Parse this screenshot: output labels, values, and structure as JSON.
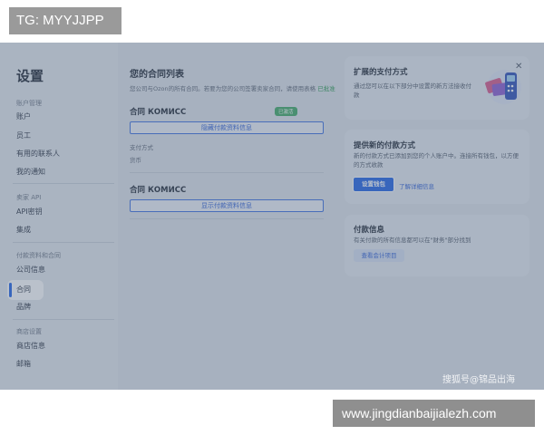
{
  "watermark_top": "TG: MYYJJPP",
  "watermark_bottom": "www.jingdianbaijialezh.com",
  "watermark_corner": "搜狐号@锦品出海",
  "sidebar": {
    "title": "设置",
    "sections": [
      {
        "label": "账户管理",
        "items": [
          "账户",
          "员工",
          "有用的联系人",
          "我的通知"
        ]
      },
      {
        "label": "卖家 API",
        "items": [
          "API密钥",
          "集成"
        ]
      },
      {
        "label": "付款资料和合同",
        "items": [
          "公司信息",
          "合同",
          "品牌"
        ]
      },
      {
        "label": "商店设置",
        "items": [
          "商店信息",
          "邮箱"
        ]
      }
    ],
    "active_item": "合同"
  },
  "main": {
    "title": "您的合同列表",
    "subtitle": "您公司与Ozon的所有合同。若要为您的公司签署卖家合同，请使用表格",
    "subtitle_link": "已批准",
    "contracts": [
      {
        "title": "合同 КОМИСС",
        "badge": "已激活",
        "button": "隐藏付款资料信息",
        "fields": [
          "支付方式",
          "货币"
        ]
      },
      {
        "title": "合同 КОМИСС",
        "button": "显示付款资料信息"
      }
    ]
  },
  "cards": {
    "payment_methods": {
      "title": "扩展的支付方式",
      "text": "通过您可以在以下部分中设置的新方法接收付款"
    },
    "new_payment": {
      "title": "提供新的付款方式",
      "text": "新的付款方式已添加到您的个人账户中。连接所有钱包，以方便的方式收款",
      "primary_button": "设置钱包",
      "link": "了解详细信息"
    },
    "payment_info": {
      "title": "付款信息",
      "text": "有关付款的所有信息都可以在\"财务\"部分找到",
      "button": "查看会计项目"
    }
  },
  "colors": {
    "accent": "#1f62e6",
    "badge_green": "#3faa64"
  }
}
